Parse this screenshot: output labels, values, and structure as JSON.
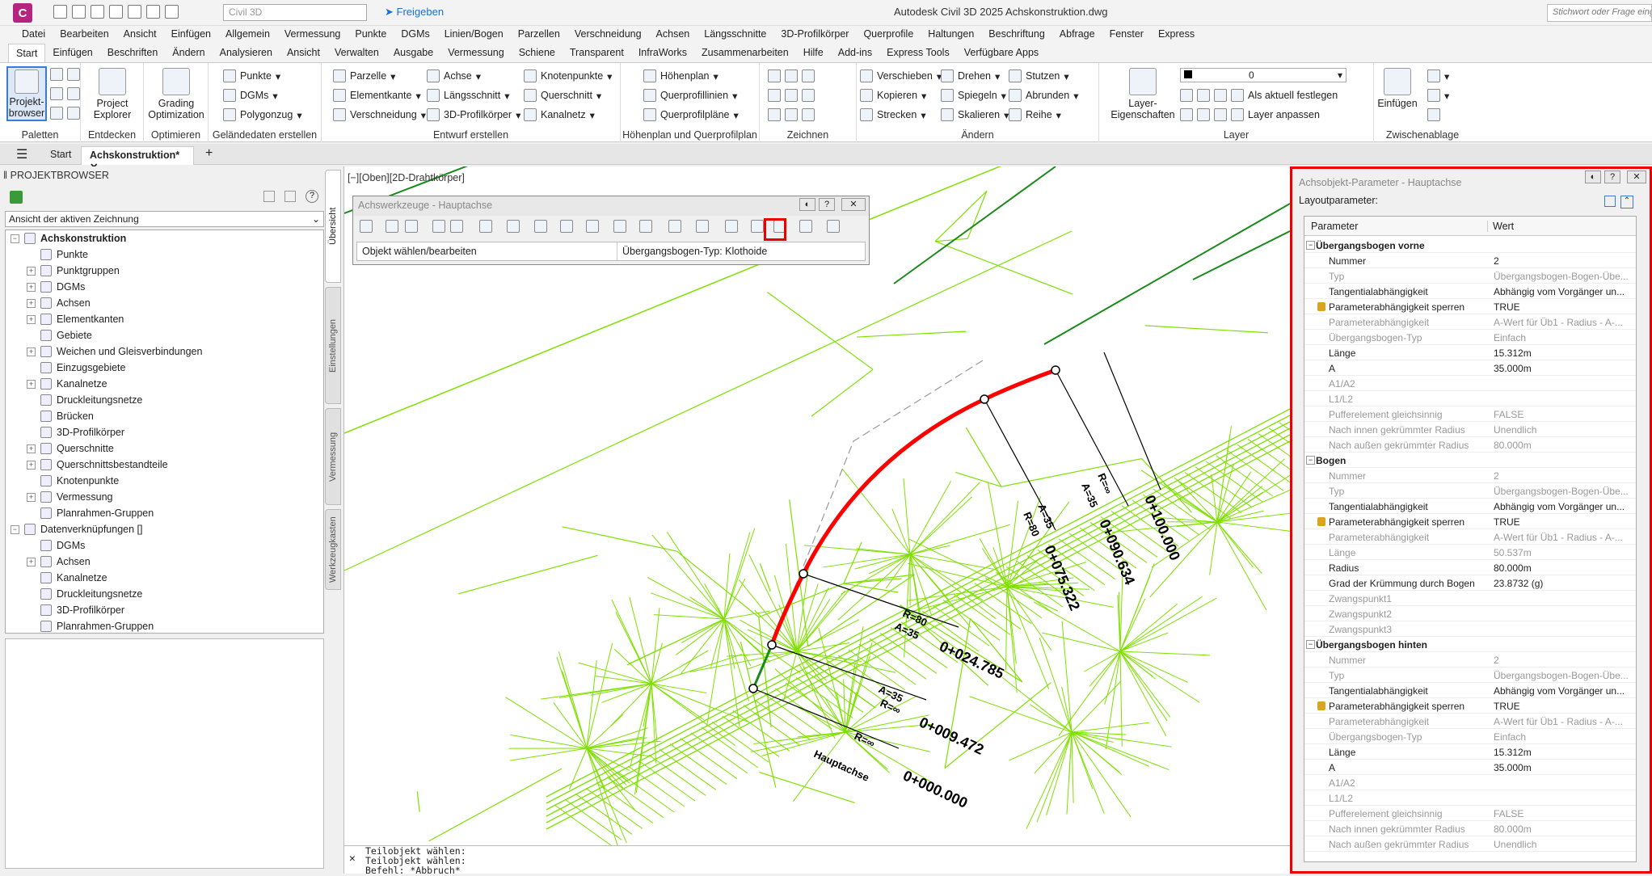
{
  "app": {
    "logo_letter": "C",
    "title": "Autodesk Civil 3D 2025    Achskonstruktion.dwg",
    "workspace": "Civil 3D",
    "share": "Freigeben",
    "search_placeholder": "Stichwort oder Frage eing"
  },
  "menu": [
    "Datei",
    "Bearbeiten",
    "Ansicht",
    "Einfügen",
    "Allgemein",
    "Vermessung",
    "Punkte",
    "DGMs",
    "Linien/Bogen",
    "Parzellen",
    "Verschneidung",
    "Achsen",
    "Längsschnitte",
    "3D-Profilkörper",
    "Querprofile",
    "Haltungen",
    "Beschriftung",
    "Abfrage",
    "Fenster",
    "Express"
  ],
  "tabs": [
    "Start",
    "Einfügen",
    "Beschriften",
    "Ändern",
    "Analysieren",
    "Ansicht",
    "Verwalten",
    "Ausgabe",
    "Vermessung",
    "Schiene",
    "Transparent",
    "InfraWorks",
    "Zusammenarbeiten",
    "Hilfe",
    "Add-ins",
    "Express Tools",
    "Verfügbare Apps"
  ],
  "ribbon": {
    "paletten": {
      "btn": "Projekt-browser",
      "title": "Paletten"
    },
    "entdecken": {
      "btn": "Project Explorer",
      "title": "Entdecken"
    },
    "optimieren": {
      "btn": "Grading Optimization",
      "title": "Optimieren"
    },
    "gelaende": {
      "items": [
        "Punkte",
        "DGMs",
        "Polygonzug"
      ],
      "title": "Geländedaten erstellen"
    },
    "entwurf": {
      "col1": [
        "Parzelle",
        "Elementkante",
        "Verschneidung"
      ],
      "col2": [
        "Achse",
        "Längsschnitt",
        "3D-Profilkörper"
      ],
      "col3": [
        "Knotenpunkte",
        "Querschnitt",
        "Kanalnetz"
      ],
      "title": "Entwurf erstellen"
    },
    "hoehenplan": {
      "items": [
        "Höhenplan",
        "Querprofillinien",
        "Querprofilpläne"
      ],
      "title": "Höhenplan und Querprofilplan"
    },
    "zeichnen": {
      "title": "Zeichnen"
    },
    "aendern": {
      "col1": [
        "Verschieben",
        "Kopieren",
        "Strecken"
      ],
      "col2": [
        "Drehen",
        "Spiegeln",
        "Skalieren"
      ],
      "col3": [
        "Stutzen",
        "Abrunden",
        "Reihe"
      ],
      "title": "Ändern"
    },
    "layer": {
      "btn": "Layer-Eigenschaften",
      "current": "0",
      "items": [
        "Als aktuell festlegen",
        "Layer anpassen"
      ],
      "title": "Layer"
    },
    "zwischenablage": {
      "btn": "Einfügen",
      "title": "Zwischenablage"
    }
  },
  "doc_tabs": [
    "Start",
    "Achskonstruktion*"
  ],
  "browser": {
    "title": "PROJEKTBROWSER",
    "view_select": "Ansicht der aktiven Zeichnung",
    "tree": [
      {
        "label": "Achskonstruktion",
        "level": 0,
        "bold": true,
        "exp": "−"
      },
      {
        "label": "Punkte",
        "level": 1,
        "exp": ""
      },
      {
        "label": "Punktgruppen",
        "level": 1,
        "exp": "+"
      },
      {
        "label": "DGMs",
        "level": 1,
        "exp": "+"
      },
      {
        "label": "Achsen",
        "level": 1,
        "exp": "+"
      },
      {
        "label": "Elementkanten",
        "level": 1,
        "exp": "+"
      },
      {
        "label": "Gebiete",
        "level": 1,
        "exp": ""
      },
      {
        "label": "Weichen und Gleisverbindungen",
        "level": 1,
        "exp": "+"
      },
      {
        "label": "Einzugsgebiete",
        "level": 1,
        "exp": ""
      },
      {
        "label": "Kanalnetze",
        "level": 1,
        "exp": "+"
      },
      {
        "label": "Druckleitungsnetze",
        "level": 1,
        "exp": ""
      },
      {
        "label": "Brücken",
        "level": 1,
        "exp": ""
      },
      {
        "label": "3D-Profilkörper",
        "level": 1,
        "exp": ""
      },
      {
        "label": "Querschnitte",
        "level": 1,
        "exp": "+"
      },
      {
        "label": "Querschnittsbestandteile",
        "level": 1,
        "exp": "+"
      },
      {
        "label": "Knotenpunkte",
        "level": 1,
        "exp": ""
      },
      {
        "label": "Vermessung",
        "level": 1,
        "exp": "+"
      },
      {
        "label": "Planrahmen-Gruppen",
        "level": 1,
        "exp": ""
      },
      {
        "label": "Datenverknüpfungen []",
        "level": 0,
        "exp": "−"
      },
      {
        "label": "DGMs",
        "level": 1,
        "exp": ""
      },
      {
        "label": "Achsen",
        "level": 1,
        "exp": "+"
      },
      {
        "label": "Kanalnetze",
        "level": 1,
        "exp": ""
      },
      {
        "label": "Druckleitungsnetze",
        "level": 1,
        "exp": ""
      },
      {
        "label": "3D-Profilkörper",
        "level": 1,
        "exp": ""
      },
      {
        "label": "Planrahmen-Gruppen",
        "level": 1,
        "exp": ""
      }
    ],
    "side_tabs": [
      "Übersicht",
      "Einstellungen",
      "Vermessung",
      "Werkzeugkasten"
    ]
  },
  "viewport_label": "[−][Oben][2D-Drahtkörper]",
  "toolwin": {
    "title": "Achswerkzeuge - Hauptachse",
    "field1": "Objekt wählen/bearbeiten",
    "field2": "Übergangsbogen-Typ: Klothoide"
  },
  "drawing_labels": {
    "station0": "0+000.000",
    "station1": "0+009.472",
    "station2": "0+024.785",
    "station3": "0+075.322",
    "station4": "0+090.634",
    "station5": "0+100.000",
    "axis_name": "Hauptachse",
    "r_inf": "R=∞",
    "a35": "A=35",
    "r80": "R=80"
  },
  "command": {
    "lines": [
      "Teilobjekt wählen:",
      "Teilobjekt wählen:",
      "Befehl: *Abbruch*"
    ]
  },
  "props": {
    "title": "Achsobjekt-Parameter - Hauptachse",
    "layout_label": "Layoutparameter:",
    "col_param": "Parameter",
    "col_value": "Wert",
    "rows": [
      {
        "g": true,
        "n": "Übergangsbogen vorne"
      },
      {
        "n": "Nummer",
        "v": "2",
        "d": false
      },
      {
        "n": "Typ",
        "v": "Übergangsbogen-Bogen-Übe...",
        "d": true
      },
      {
        "n": "Tangentialabhängigkeit",
        "v": "Abhängig vom Vorgänger un...",
        "d": false
      },
      {
        "n": "Parameterabhängigkeit sperren",
        "v": "TRUE",
        "d": false,
        "lock": true
      },
      {
        "n": "Parameterabhängigkeit",
        "v": "A-Wert für Üb1 - Radius - A-...",
        "d": true
      },
      {
        "n": "Übergangsbogen-Typ",
        "v": "Einfach",
        "d": true
      },
      {
        "n": "Länge",
        "v": "15.312m",
        "d": false
      },
      {
        "n": "A",
        "v": "35.000m",
        "d": false
      },
      {
        "n": "A1/A2",
        "v": "",
        "d": true
      },
      {
        "n": "L1/L2",
        "v": "",
        "d": true
      },
      {
        "n": "Pufferelement gleichsinnig",
        "v": "FALSE",
        "d": true
      },
      {
        "n": "Nach innen gekrümmter Radius",
        "v": "Unendlich",
        "d": true
      },
      {
        "n": "Nach außen gekrümmter Radius",
        "v": "80.000m",
        "d": true
      },
      {
        "g": true,
        "n": "Bogen"
      },
      {
        "n": "Nummer",
        "v": "2",
        "d": true
      },
      {
        "n": "Typ",
        "v": "Übergangsbogen-Bogen-Übe...",
        "d": true
      },
      {
        "n": "Tangentialabhängigkeit",
        "v": "Abhängig vom Vorgänger un...",
        "d": false
      },
      {
        "n": "Parameterabhängigkeit sperren",
        "v": "TRUE",
        "d": false,
        "lock": true
      },
      {
        "n": "Parameterabhängigkeit",
        "v": "A-Wert für Üb1 - Radius - A-...",
        "d": true
      },
      {
        "n": "Länge",
        "v": "50.537m",
        "d": true
      },
      {
        "n": "Radius",
        "v": "80.000m",
        "d": false
      },
      {
        "n": "Grad der Krümmung durch Bogen",
        "v": "23.8732 (g)",
        "d": false
      },
      {
        "n": "Zwangspunkt1",
        "v": "",
        "d": true
      },
      {
        "n": "Zwangspunkt2",
        "v": "",
        "d": true
      },
      {
        "n": "Zwangspunkt3",
        "v": "",
        "d": true
      },
      {
        "g": true,
        "n": "Übergangsbogen hinten"
      },
      {
        "n": "Nummer",
        "v": "2",
        "d": true
      },
      {
        "n": "Typ",
        "v": "Übergangsbogen-Bogen-Übe...",
        "d": true
      },
      {
        "n": "Tangentialabhängigkeit",
        "v": "Abhängig vom Vorgänger un...",
        "d": false
      },
      {
        "n": "Parameterabhängigkeit sperren",
        "v": "TRUE",
        "d": false,
        "lock": true
      },
      {
        "n": "Parameterabhängigkeit",
        "v": "A-Wert für Üb1 - Radius - A-...",
        "d": true
      },
      {
        "n": "Übergangsbogen-Typ",
        "v": "Einfach",
        "d": true
      },
      {
        "n": "Länge",
        "v": "15.312m",
        "d": false
      },
      {
        "n": "A",
        "v": "35.000m",
        "d": false
      },
      {
        "n": "A1/A2",
        "v": "",
        "d": true
      },
      {
        "n": "L1/L2",
        "v": "",
        "d": true
      },
      {
        "n": "Pufferelement gleichsinnig",
        "v": "FALSE",
        "d": true
      },
      {
        "n": "Nach innen gekrümmter Radius",
        "v": "80.000m",
        "d": true
      },
      {
        "n": "Nach außen gekrümmter Radius",
        "v": "Unendlich",
        "d": true
      }
    ]
  },
  "colors": {
    "highlight": "#e00000",
    "alignment_curve": "#ff0000",
    "alignment_tangent": "#1a8a1a",
    "tin": "#7ee000"
  }
}
